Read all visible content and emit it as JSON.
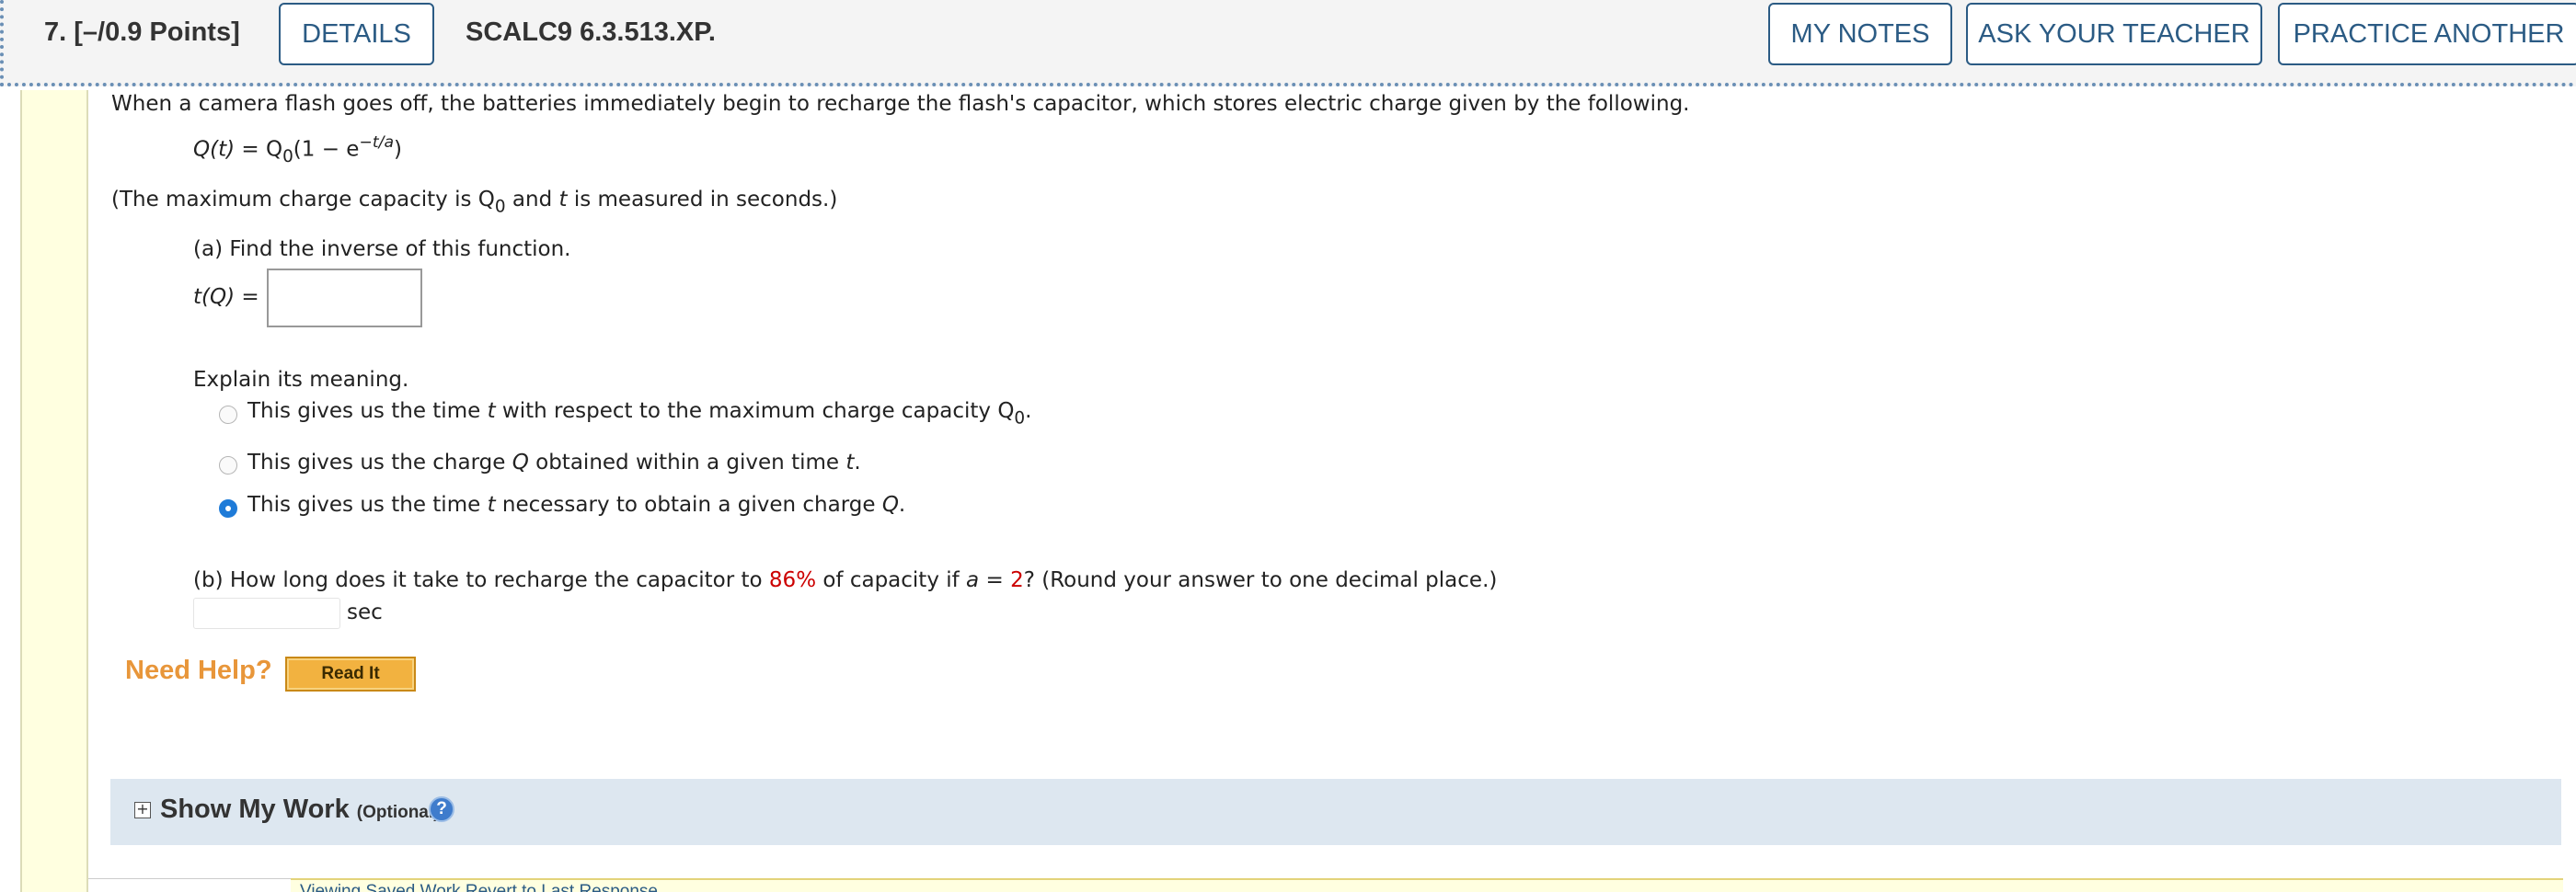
{
  "header": {
    "question_label": "7.  [–/0.9 Points]",
    "details_label": "DETAILS",
    "problem_code": "SCALC9 6.3.513.XP.",
    "my_notes_label": "MY NOTES",
    "ask_teacher_label": "ASK YOUR TEACHER",
    "practice_label": "PRACTICE ANOTHER"
  },
  "problem": {
    "intro": "When a camera flash goes off, the batteries immediately begin to recharge the flash's capacitor, which stores electric charge given by the following.",
    "formula": {
      "lhs": "Q(t)",
      "eq": " = Q",
      "sub": "0",
      "paren_open": "(1 − e",
      "exp": "−t/a",
      "paren_close": ")"
    },
    "note": {
      "prefix": "(The maximum charge capacity is Q",
      "sub": "0",
      "middle": " and ",
      "t": "t",
      "suffix": " is measured in seconds.)"
    }
  },
  "part_a": {
    "prompt": "(a) Find the inverse of this function.",
    "answer_label": "t(Q) =",
    "answer_value": "",
    "explain_label": "Explain its meaning.",
    "options": [
      {
        "before": "This gives us the time ",
        "var": "t",
        "after": " with respect to the maximum charge capacity Q",
        "sub": "0",
        "end": ".",
        "selected": false
      },
      {
        "before": "This gives us the charge ",
        "var": "Q",
        "after": " obtained within a given time ",
        "var2": "t",
        "end": ".",
        "selected": false
      },
      {
        "before": "This gives us the time ",
        "var": "t",
        "after": " necessary to obtain a given charge ",
        "var2": "Q",
        "end": ".",
        "selected": true
      }
    ]
  },
  "part_b": {
    "prefix": "(b) How long does it take to recharge the capacitor to ",
    "percent": "86%",
    "middle": " of capacity if ",
    "a_var": "a",
    "equals": " = ",
    "a_value": "2",
    "suffix": "? (Round your answer to one decimal place.)",
    "answer_value": "",
    "unit": "sec"
  },
  "help": {
    "need_help_label": "Need Help?",
    "read_it_label": "Read It"
  },
  "show_work": {
    "plus_symbol": "+",
    "title": "Show My Work",
    "optional_label": "(Optional)",
    "help_symbol": "?"
  },
  "footer": {
    "partial_link_text": "Viewing Saved Work Revert to Last Response"
  },
  "colors": {
    "accent": "#2b5b84",
    "highlight_red": "#cc0000",
    "need_help_orange": "#e8963a",
    "radio_selected": "#1e7bd8"
  }
}
